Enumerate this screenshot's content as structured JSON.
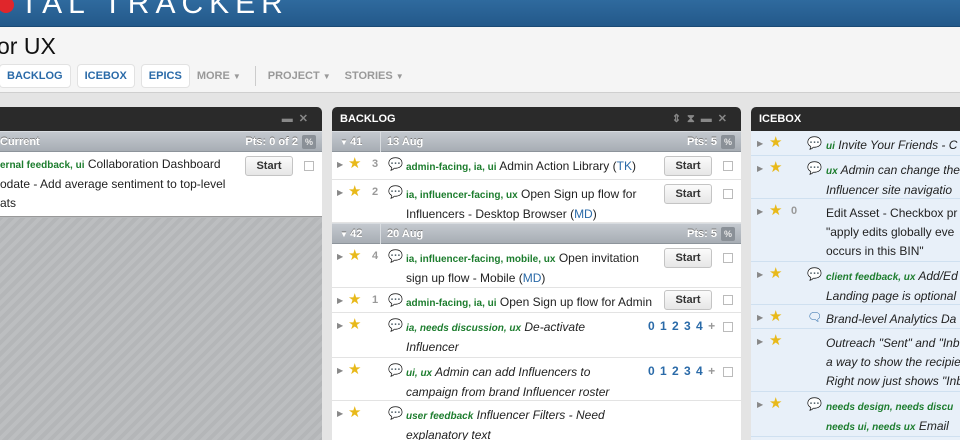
{
  "brand": {
    "text": "OTALTRACKER",
    "visible_text": "TAL TRACKER"
  },
  "project": {
    "title": "or UX"
  },
  "nav": {
    "backlog": "BACKLOG",
    "icebox": "ICEBOX",
    "epics": "EPICS",
    "more": "MORE",
    "project": "PROJECT",
    "stories": "STORIES"
  },
  "current": {
    "iteration_label": "Current",
    "points": "Pts: 0 of 2",
    "pct": "%",
    "story": {
      "labels": "ernal feedback, ui",
      "title": "Collaboration Dashboard",
      "line2": "odate - Add average sentiment to top-level",
      "line3": "ats",
      "start": "Start"
    }
  },
  "backlog": {
    "title": "BACKLOG",
    "iter1": {
      "num": "41",
      "date": "13 Aug",
      "points": "Pts: 5",
      "pct": "%"
    },
    "iter2": {
      "num": "42",
      "date": "20 Aug",
      "points": "Pts: 5",
      "pct": "%"
    },
    "stories": [
      {
        "est": "3",
        "labels": "admin-facing, ia, ui",
        "title": "Admin Action Library (",
        "link": "TK",
        "tail": ")",
        "line2": "",
        "action": "Start"
      },
      {
        "est": "2",
        "labels": "ia, influencer-facing, ux",
        "title": "Open Sign up flow for",
        "line2": "Influencers - Desktop Browser (",
        "link": "MD",
        "tail": ")",
        "action": "Start"
      },
      {
        "est": "4",
        "labels": "ia, influencer-facing, mobile, ux",
        "title": "Open invitation",
        "line2": "sign up flow - Mobile (",
        "link": "MD",
        "tail": ")",
        "action": "Start"
      },
      {
        "est": "1",
        "labels": "admin-facing, ia, ui",
        "title": "Open Sign up flow for Admin",
        "action": "Start"
      },
      {
        "labels": "ia, needs discussion, ux",
        "title": "De-activate",
        "line2": "Influencer",
        "estimate_options": "0 1 2 3 4",
        "plus": "+"
      },
      {
        "labels": "ui, ux",
        "title": "Admin can add Influencers to",
        "line2": "campaign from brand Influencer roster",
        "estimate_options": "0 1 2 3 4",
        "plus": "+"
      },
      {
        "labels": "user feedback",
        "title": "Influencer Filters - Need",
        "line2": "explanatory text"
      }
    ]
  },
  "icebox": {
    "title": "ICEBOX",
    "stories": [
      {
        "labels": "ui",
        "text": "Invite Your Friends - C"
      },
      {
        "labels": "ux",
        "text": "Admin can change the",
        "line2": "Influencer site navigatio"
      },
      {
        "est": "0",
        "text": "Edit Asset - Checkbox pr",
        "line2": "\"apply edits globally eve",
        "line3": "occurs in this BIN\""
      },
      {
        "labels": "client feedback, ux",
        "text": "Add/Ed",
        "line2": "Landing page is optional"
      },
      {
        "text": "Brand-level Analytics Da"
      },
      {
        "text": "Outreach \"Sent\" and \"Inb",
        "line2": "a way to show the recipie",
        "line3": "Right now just shows \"Inb"
      },
      {
        "labels": "needs design, needs discu",
        "labels2": "needs ui, needs ux",
        "text2": "Email"
      }
    ]
  },
  "colors": {
    "brand_bar": "#2f6a9e",
    "label_green": "#1d7d2e",
    "link_blue": "#2a6aa8",
    "star": "#e8b91a",
    "icebox_bg": "#e8f0f9"
  }
}
